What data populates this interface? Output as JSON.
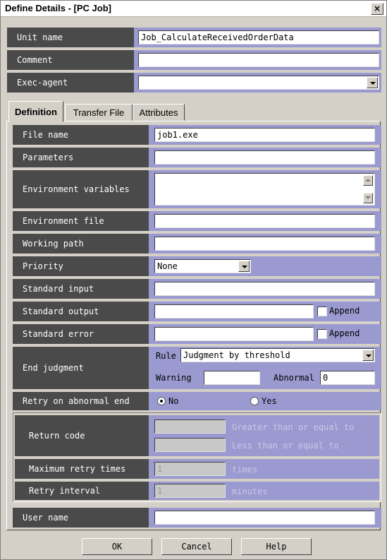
{
  "window": {
    "title": "Define Details - [PC Job]",
    "close_label": "×"
  },
  "unit_name": {
    "label": "Unit name",
    "value": "Job_CalculateReceivedOrderData"
  },
  "comment": {
    "label": "Comment",
    "value": ""
  },
  "exec_agent": {
    "label": "Exec-agent",
    "value": ""
  },
  "tabs": [
    {
      "label": "Definition",
      "active": true
    },
    {
      "label": "Transfer File",
      "active": false
    },
    {
      "label": "Attributes",
      "active": false
    }
  ],
  "definition": {
    "file_name": {
      "label": "File name",
      "value": "job1.exe"
    },
    "parameters": {
      "label": "Parameters",
      "value": ""
    },
    "environment_variables": {
      "label": "Environment variables",
      "value": ""
    },
    "environment_file": {
      "label": "Environment file",
      "value": ""
    },
    "working_path": {
      "label": "Working path",
      "value": ""
    },
    "priority": {
      "label": "Priority",
      "value": "None"
    },
    "standard_input": {
      "label": "Standard input",
      "value": ""
    },
    "standard_output": {
      "label": "Standard output",
      "value": "",
      "append_label": "Append"
    },
    "standard_error": {
      "label": "Standard error",
      "value": "",
      "append_label": "Append"
    },
    "end_judgment": {
      "label": "End judgment",
      "rule_label": "Rule",
      "rule_value": "Judgment by threshold",
      "warning_label": "Warning",
      "warning_value": "",
      "abnormal_label": "Abnormal",
      "abnormal_value": "0"
    },
    "retry": {
      "label": "Retry on abnormal end",
      "no_label": "No",
      "yes_label": "Yes",
      "selected": "No"
    },
    "return_code": {
      "label": "Return code",
      "min_value": "",
      "min_suffix": "Greater than or equal to",
      "max_value": "",
      "max_suffix": "Less than or equal to"
    },
    "max_retry": {
      "label": "Maximum retry times",
      "value": "1",
      "unit": "times"
    },
    "retry_interval": {
      "label": "Retry interval",
      "value": "1",
      "unit": "minutes"
    },
    "user_name": {
      "label": "User name",
      "value": ""
    }
  },
  "buttons": {
    "ok": "OK",
    "cancel": "Cancel",
    "help": "Help"
  }
}
